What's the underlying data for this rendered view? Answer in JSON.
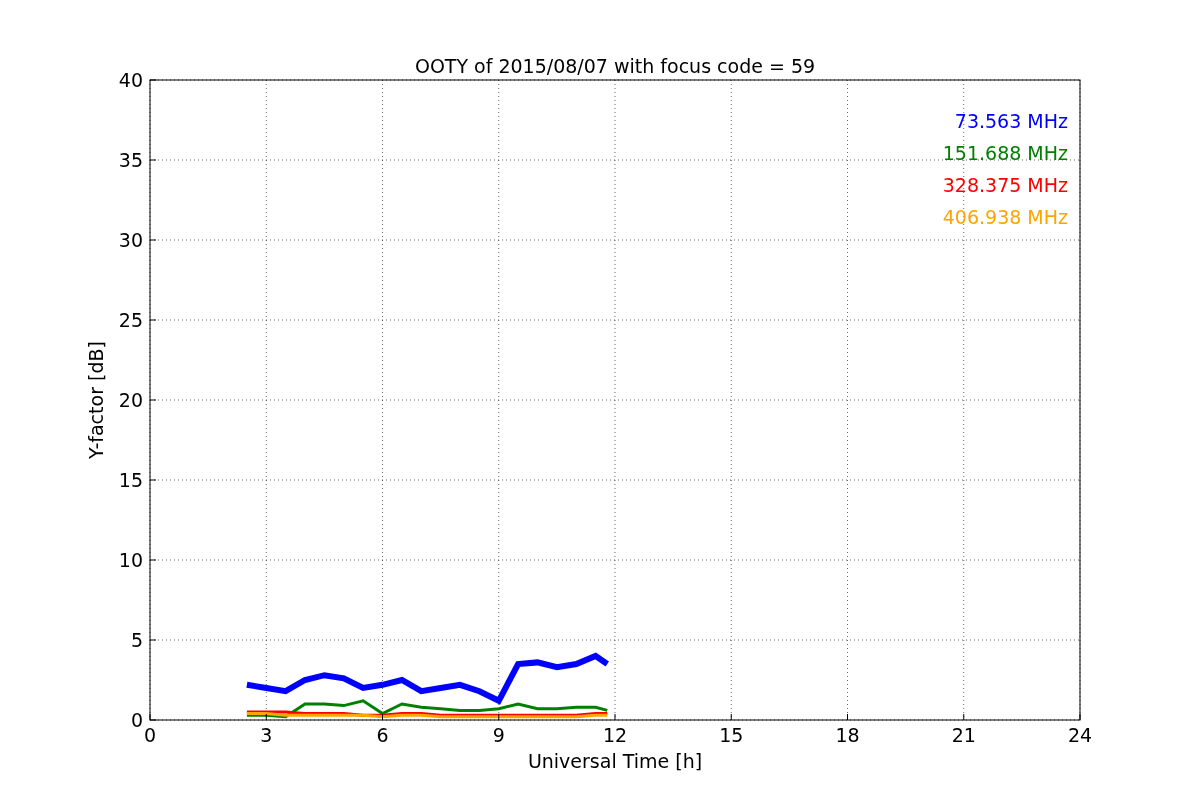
{
  "figure": {
    "chart_data": {
      "type": "line",
      "title": "OOTY of 2015/08/07 with focus code = 59",
      "xlabel": "Universal Time [h]",
      "ylabel": "Y-factor [dB]",
      "x": [
        2.5,
        3,
        3.5,
        4,
        4.5,
        5,
        5.5,
        6,
        6.5,
        7,
        7.5,
        8,
        8.5,
        9,
        9.5,
        10,
        10.5,
        11,
        11.5,
        11.8
      ],
      "series": [
        {
          "name": "73.563 MHz",
          "color": "#0000ff",
          "values": [
            2.2,
            2.0,
            1.8,
            2.5,
            2.8,
            2.6,
            2.0,
            2.2,
            2.5,
            1.8,
            2.0,
            2.2,
            1.8,
            1.2,
            3.5,
            3.6,
            3.3,
            3.5,
            4.0,
            3.5
          ]
        },
        {
          "name": "151.688 MHz",
          "color": "#008000",
          "values": [
            0.3,
            0.3,
            0.2,
            1.0,
            1.0,
            0.9,
            1.2,
            0.4,
            1.0,
            0.8,
            0.7,
            0.6,
            0.6,
            0.7,
            1.0,
            0.7,
            0.7,
            0.8,
            0.8,
            0.6
          ]
        },
        {
          "name": "328.375 MHz",
          "color": "#ff0000",
          "values": [
            0.5,
            0.5,
            0.5,
            0.4,
            0.4,
            0.4,
            0.3,
            0.3,
            0.4,
            0.4,
            0.3,
            0.3,
            0.3,
            0.3,
            0.3,
            0.3,
            0.3,
            0.3,
            0.4,
            0.4
          ]
        },
        {
          "name": "406.938 MHz",
          "color": "#ffa500",
          "values": [
            0.4,
            0.4,
            0.3,
            0.3,
            0.3,
            0.3,
            0.3,
            0.2,
            0.3,
            0.3,
            0.2,
            0.2,
            0.2,
            0.2,
            0.2,
            0.2,
            0.2,
            0.2,
            0.3,
            0.3
          ]
        }
      ],
      "xlim": [
        0,
        24
      ],
      "ylim": [
        0,
        40
      ],
      "xticks": [
        0,
        3,
        6,
        9,
        12,
        15,
        18,
        21,
        24
      ],
      "yticks": [
        0,
        5,
        10,
        15,
        20,
        25,
        30,
        35,
        40
      ],
      "grid": true
    }
  }
}
